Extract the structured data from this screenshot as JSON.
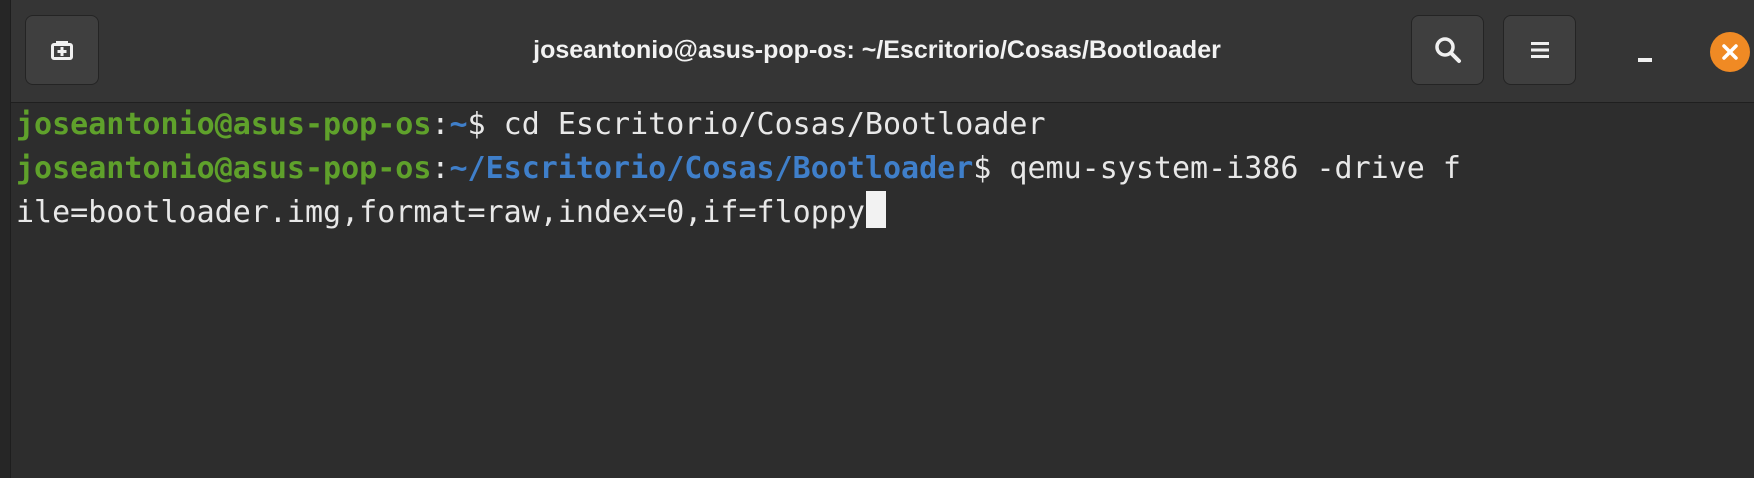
{
  "window": {
    "title": "joseantonio@asus-pop-os: ~/Escritorio/Cosas/Bootloader"
  },
  "toolbar": {
    "new_tab_icon": "new-tab-icon",
    "search_icon": "search-icon",
    "menu_icon": "hamburger-menu-icon",
    "minimize_icon": "minimize-icon",
    "close_icon": "close-icon"
  },
  "terminal": {
    "lines": [
      {
        "user_host": "joseantonio@asus-pop-os",
        "separator": ":",
        "path": "~",
        "prompt": "$",
        "command": " cd Escritorio/Cosas/Bootloader"
      },
      {
        "user_host": "joseantonio@asus-pop-os",
        "separator": ":",
        "path": "~/Escritorio/Cosas/Bootloader",
        "prompt": "$",
        "command": " qemu-system-i386 -drive f"
      },
      {
        "text": "ile=bootloader.img,format=raw,index=0,if=floppy"
      }
    ]
  },
  "colors": {
    "user": "#5fa12b",
    "path": "#3f7fca",
    "close": "#f08a24",
    "background": "#2d2d2d"
  }
}
